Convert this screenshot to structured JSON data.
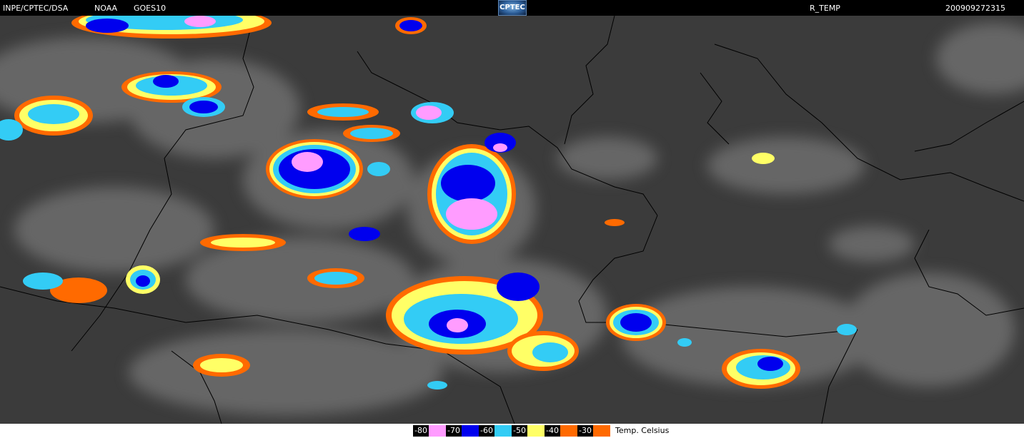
{
  "header": {
    "agency": "INPE/CPTEC/DSA",
    "source": "NOAA",
    "satellite": "GOES10",
    "logo_text": "CPTEC",
    "product": "R_TEMP",
    "timestamp": "200909272315"
  },
  "legend": {
    "items": [
      {
        "label": "-80",
        "color": "#ff9cff"
      },
      {
        "label": "-70",
        "color": "#0000ee"
      },
      {
        "label": "-60",
        "color": "#33ccf5"
      },
      {
        "label": "-50",
        "color": "#ffff66"
      },
      {
        "label": "-40",
        "color": "#ff6a00"
      },
      {
        "label": "-30",
        "color": "#3a3a3a"
      }
    ],
    "unit": "Temp. Celsius"
  }
}
